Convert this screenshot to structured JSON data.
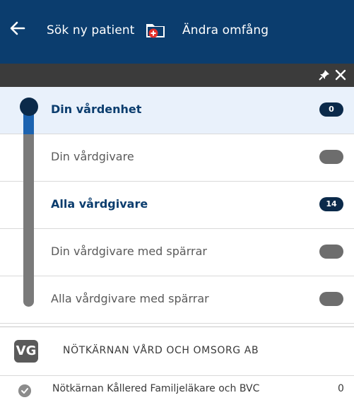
{
  "header": {
    "back_icon": "arrow-left-icon",
    "new_patient_label": "Sök ny patient",
    "folder_icon": "folder-medical-icon",
    "change_scope_label": "Ändra omfång",
    "background": "#0b3d6e"
  },
  "toolbar": {
    "pin_icon": "pin-icon",
    "close_icon": "close-icon"
  },
  "levels": [
    {
      "label": "Din vårdenhet",
      "badge": "0",
      "active": true,
      "selected": true
    },
    {
      "label": "Din vårdgivare",
      "badge": "",
      "active": false,
      "selected": false
    },
    {
      "label": "Alla vårdgivare",
      "badge": "14",
      "active": true,
      "selected": false
    },
    {
      "label": "Din vårdgivare med spärrar",
      "badge": "",
      "active": false,
      "selected": false
    },
    {
      "label": "Alla vårdgivare med spärrar",
      "badge": "",
      "active": false,
      "selected": false
    }
  ],
  "care_provider": {
    "abbreviation": "VG",
    "name": "Nötkärnan Vård och Omsorg AB"
  },
  "care_units": [
    {
      "name": "Nötkärnan Kållered Familjeläkare och BVC",
      "count": "0"
    }
  ],
  "colors": {
    "accent": "#1c63b0",
    "dark_accent": "#0b2a4a",
    "inactive": "#6d6d6d"
  }
}
